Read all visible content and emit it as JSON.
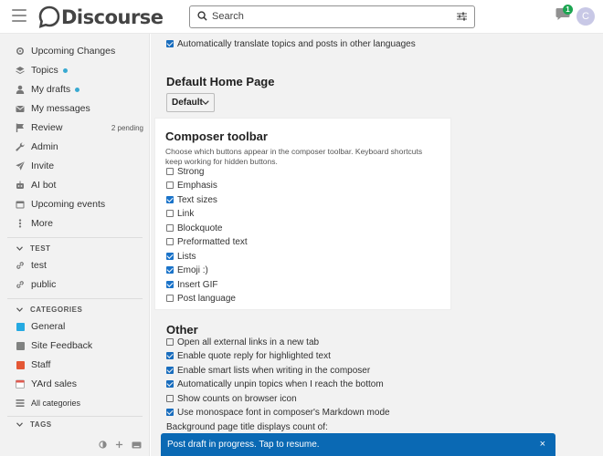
{
  "header": {
    "logo_text": "Discourse",
    "search_placeholder": "Search",
    "notification_count": "1",
    "avatar_letter": "C"
  },
  "sidebar": {
    "items": [
      {
        "label": "Upcoming Changes",
        "icon": "gear-icon"
      },
      {
        "label": "Topics",
        "icon": "layers-icon",
        "dot": true
      },
      {
        "label": "My drafts",
        "icon": "user-icon",
        "dot": true
      },
      {
        "label": "My messages",
        "icon": "envelope-icon"
      },
      {
        "label": "Review",
        "icon": "flag-icon",
        "pending": "2 pending"
      },
      {
        "label": "Admin",
        "icon": "wrench-icon"
      },
      {
        "label": "Invite",
        "icon": "paper-plane-icon"
      },
      {
        "label": "AI bot",
        "icon": "robot-icon"
      },
      {
        "label": "Upcoming events",
        "icon": "calendar-icon"
      },
      {
        "label": "More",
        "icon": "ellipsis-icon"
      }
    ],
    "section_test": "TEST",
    "test_links": [
      {
        "label": "test",
        "icon": "link-icon"
      },
      {
        "label": "public",
        "icon": "link-icon"
      }
    ],
    "section_categories": "CATEGORIES",
    "categories": [
      {
        "label": "General",
        "color": "#25aae2"
      },
      {
        "label": "Site Feedback",
        "color": "#808281"
      },
      {
        "label": "Staff",
        "color": "#e45735"
      },
      {
        "label": "YArd sales",
        "color": "#92278f"
      },
      {
        "label": "All categories",
        "color": ""
      }
    ],
    "section_tags": "TAGS"
  },
  "main": {
    "top_option": "Automatically translate topics and posts in other languages",
    "default_home_heading": "Default Home Page",
    "default_home_value": "Default",
    "composer": {
      "title": "Composer toolbar",
      "description": "Choose which buttons appear in the composer toolbar. Keyboard shortcuts keep working for hidden buttons.",
      "options": [
        {
          "label": "Strong",
          "checked": false
        },
        {
          "label": "Emphasis",
          "checked": false
        },
        {
          "label": "Text sizes",
          "checked": true
        },
        {
          "label": "Link",
          "checked": false
        },
        {
          "label": "Blockquote",
          "checked": false
        },
        {
          "label": "Preformatted text",
          "checked": false
        },
        {
          "label": "Lists",
          "checked": true
        },
        {
          "label": "Emoji :)",
          "checked": true
        },
        {
          "label": "Insert GIF",
          "checked": true
        },
        {
          "label": "Post language",
          "checked": false
        }
      ]
    },
    "other_heading": "Other",
    "other_options": [
      {
        "label": "Open all external links in a new tab",
        "checked": false
      },
      {
        "label": "Enable quote reply for highlighted text",
        "checked": true
      },
      {
        "label": "Enable smart lists when writing in the composer",
        "checked": true
      },
      {
        "label": "Automatically unpin topics when I reach the bottom",
        "checked": true
      },
      {
        "label": "Show counts on browser icon",
        "checked": false
      },
      {
        "label": "Use monospace font in composer's Markdown mode",
        "checked": true
      }
    ],
    "bg_title_label": "Background page title displays count of:"
  },
  "toast": {
    "text": "Post draft in progress. Tap to resume.",
    "close": "×"
  },
  "colors": {
    "accent": "#1a73c9",
    "toast_bg": "#0a69b4",
    "unread_dot": "#38a9d1"
  }
}
